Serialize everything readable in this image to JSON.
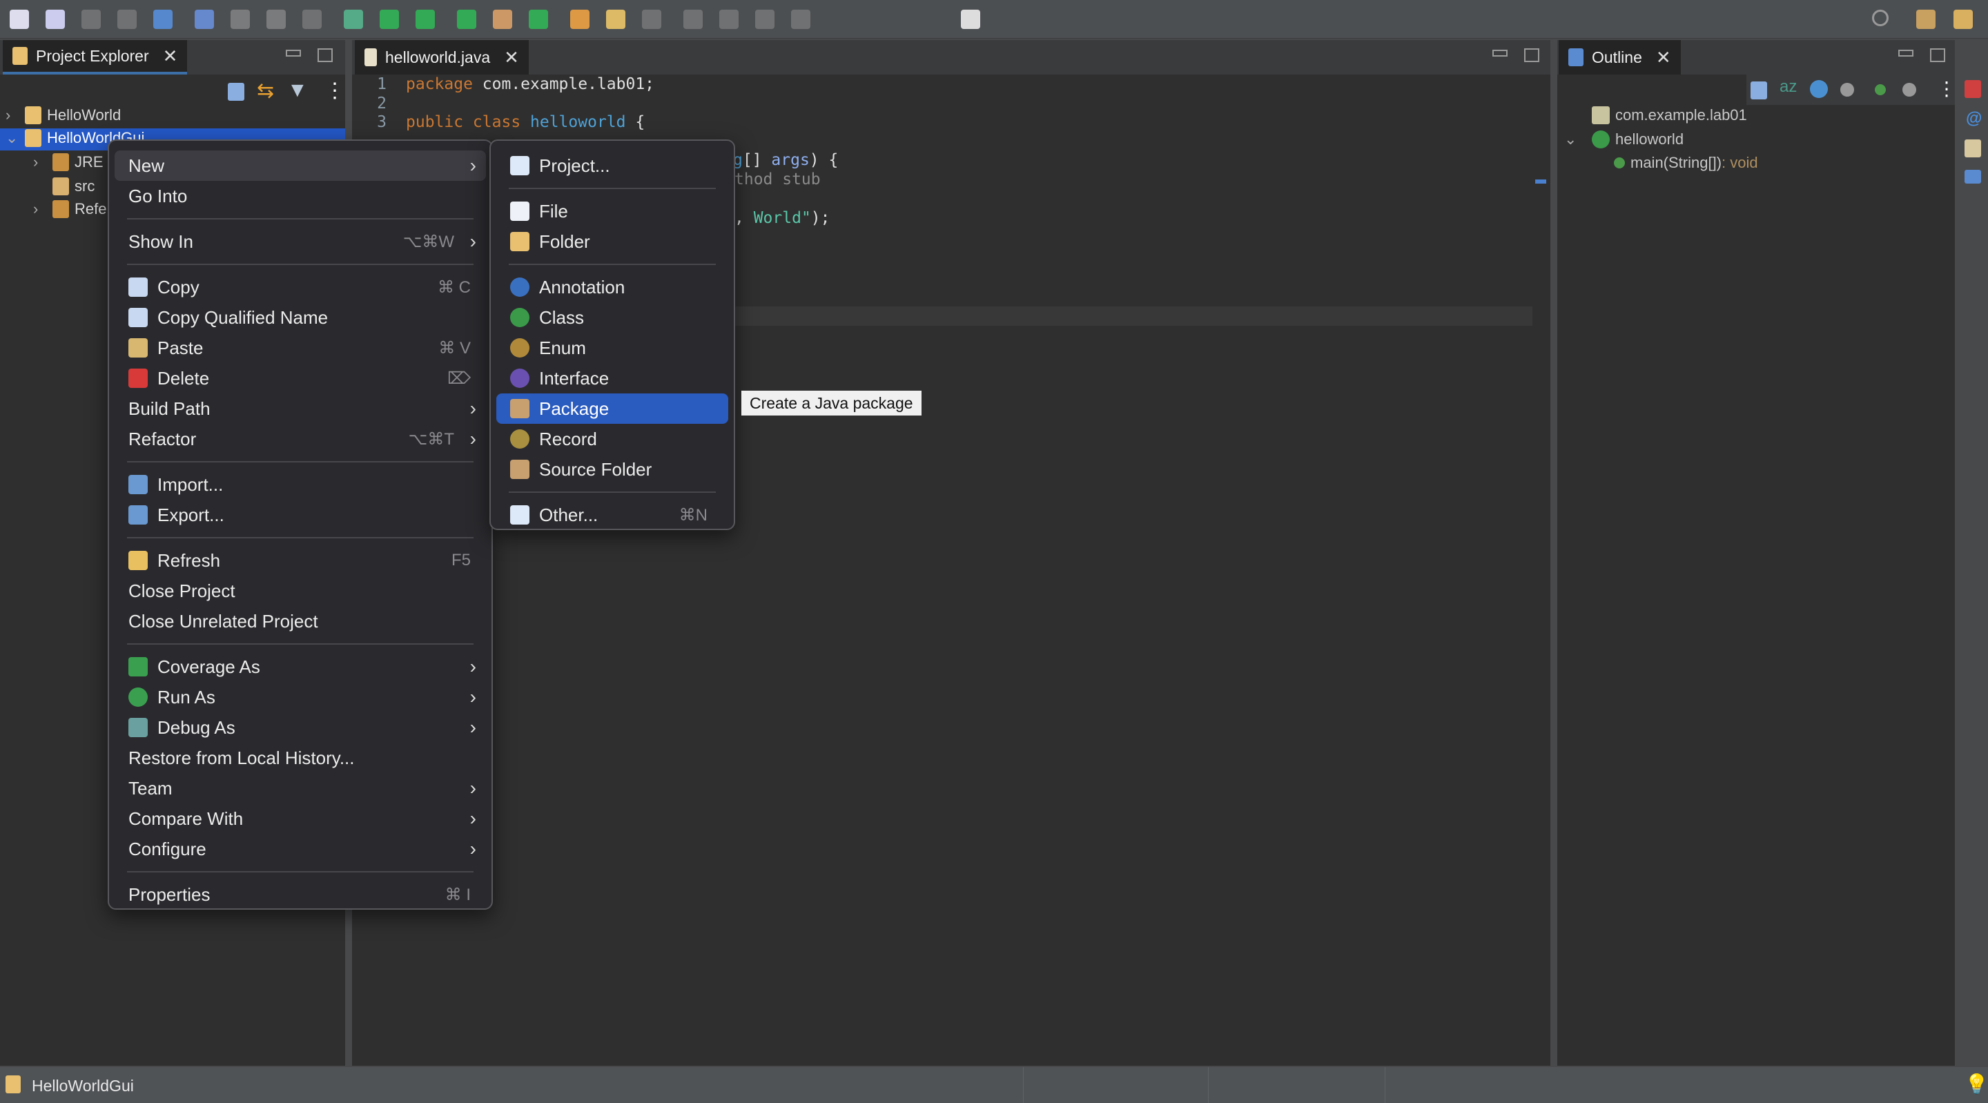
{
  "toolbar": {
    "icons": [
      "new-icon",
      "new-dropdown-icon",
      "save-icon",
      "save-all-icon",
      "open-type-icon",
      "search-icon",
      "toggle-mark-icon",
      "pen-icon",
      "show-whitespace-icon",
      "debug-icon",
      "run-icon",
      "coverage-icon",
      "external-tools-icon",
      "new-package-icon",
      "new-class-icon",
      "open-folder-icon",
      "pen-tool-icon",
      "next-annotation-icon",
      "prev-annotation-icon",
      "last-edit-icon",
      "back-icon",
      "forward-icon",
      "perspective-icon"
    ]
  },
  "project_explorer": {
    "tab_label": "Project Explorer",
    "tree": [
      {
        "label": "HelloWorld",
        "expanded": false,
        "icon": "java-project-icon"
      },
      {
        "label": "HelloWorldGui",
        "expanded": true,
        "selected": true,
        "icon": "java-project-icon"
      },
      {
        "label": "JRE",
        "expanded": false,
        "icon": "library-icon"
      },
      {
        "label": "src",
        "icon": "source-folder-icon"
      },
      {
        "label": "Refe",
        "expanded": false,
        "icon": "library-icon"
      }
    ]
  },
  "editor": {
    "tab_label": "helloworld.java",
    "lines": [
      {
        "n": "1",
        "parts": [
          [
            "kw",
            "package"
          ],
          [
            "pl",
            " com.example.lab01;"
          ]
        ]
      },
      {
        "n": "2",
        "parts": []
      },
      {
        "n": "3",
        "parts": [
          [
            "kw",
            "public class "
          ],
          [
            "ty",
            "helloworld"
          ],
          [
            "pl",
            " {"
          ]
        ]
      }
    ],
    "fragments": {
      "args_line": [
        [
          "ty",
          "g"
        ],
        [
          "pl",
          "[] "
        ],
        [
          "ar",
          "args"
        ],
        [
          "pl",
          ") {"
        ]
      ],
      "stub_line": [
        [
          "cm",
          "thod stub"
        ]
      ],
      "print_line": [
        [
          "pl",
          ", "
        ],
        [
          "str",
          "World\""
        ],
        [
          "pl",
          ");"
        ]
      ]
    }
  },
  "outline": {
    "tab_label": "Outline",
    "tree": [
      {
        "label": "com.example.lab01",
        "icon": "package-icon"
      },
      {
        "label": "helloworld",
        "icon": "class-icon",
        "expanded": true
      },
      {
        "label": "main(String[])",
        "type": " : void",
        "icon": "method-icon"
      }
    ]
  },
  "context_menu": {
    "groups": [
      [
        {
          "label": "New",
          "submenu": true,
          "hover": true
        },
        {
          "label": "Go Into"
        }
      ],
      [
        {
          "label": "Show In",
          "shortcut": "⌥⌘W",
          "submenu": true
        }
      ],
      [
        {
          "label": "Copy",
          "shortcut": "⌘ C",
          "icon": "copy-icon"
        },
        {
          "label": "Copy Qualified Name",
          "icon": "copy-qualified-name-icon"
        },
        {
          "label": "Paste",
          "shortcut": "⌘ V",
          "icon": "paste-icon"
        },
        {
          "label": "Delete",
          "shortcut": "⌦",
          "icon": "delete-icon"
        },
        {
          "label": "Build Path",
          "submenu": true
        },
        {
          "label": "Refactor",
          "shortcut": "⌥⌘T",
          "submenu": true
        }
      ],
      [
        {
          "label": "Import...",
          "icon": "import-icon"
        },
        {
          "label": "Export...",
          "icon": "export-icon"
        }
      ],
      [
        {
          "label": "Refresh",
          "shortcut": "F5",
          "icon": "refresh-icon"
        },
        {
          "label": "Close Project"
        },
        {
          "label": "Close Unrelated Project"
        }
      ],
      [
        {
          "label": "Coverage As",
          "submenu": true,
          "icon": "coverage-icon"
        },
        {
          "label": "Run As",
          "submenu": true,
          "icon": "run-icon"
        },
        {
          "label": "Debug As",
          "submenu": true,
          "icon": "debug-icon"
        },
        {
          "label": "Restore from Local History..."
        },
        {
          "label": "Team",
          "submenu": true
        },
        {
          "label": "Compare With",
          "submenu": true
        },
        {
          "label": "Configure",
          "submenu": true
        }
      ],
      [
        {
          "label": "Properties",
          "shortcut": "⌘ I"
        }
      ]
    ]
  },
  "new_submenu": {
    "groups": [
      [
        {
          "label": "Project...",
          "icon": "new-project-icon"
        }
      ],
      [
        {
          "label": "File",
          "icon": "new-file-icon"
        },
        {
          "label": "Folder",
          "icon": "new-folder-icon"
        }
      ],
      [
        {
          "label": "Annotation",
          "icon": "annotation-icon"
        },
        {
          "label": "Class",
          "icon": "class-icon"
        },
        {
          "label": "Enum",
          "icon": "enum-icon"
        },
        {
          "label": "Interface",
          "icon": "interface-icon"
        },
        {
          "label": "Package",
          "icon": "package-icon",
          "selected": true
        },
        {
          "label": "Record",
          "icon": "record-icon"
        },
        {
          "label": "Source Folder",
          "icon": "source-folder-icon"
        }
      ],
      [
        {
          "label": "Other...",
          "shortcut": "⌘N",
          "icon": "new-wizard-icon"
        }
      ]
    ]
  },
  "tooltip": {
    "text": "Create a Java package"
  },
  "status_bar": {
    "text": "HelloWorldGui"
  },
  "colors": {
    "selection": "#2a5bbf",
    "menu_bg": "#2a2a2e",
    "keyword": "#cc7832",
    "type": "#4fa3d8",
    "string": "#5ac8a8"
  }
}
